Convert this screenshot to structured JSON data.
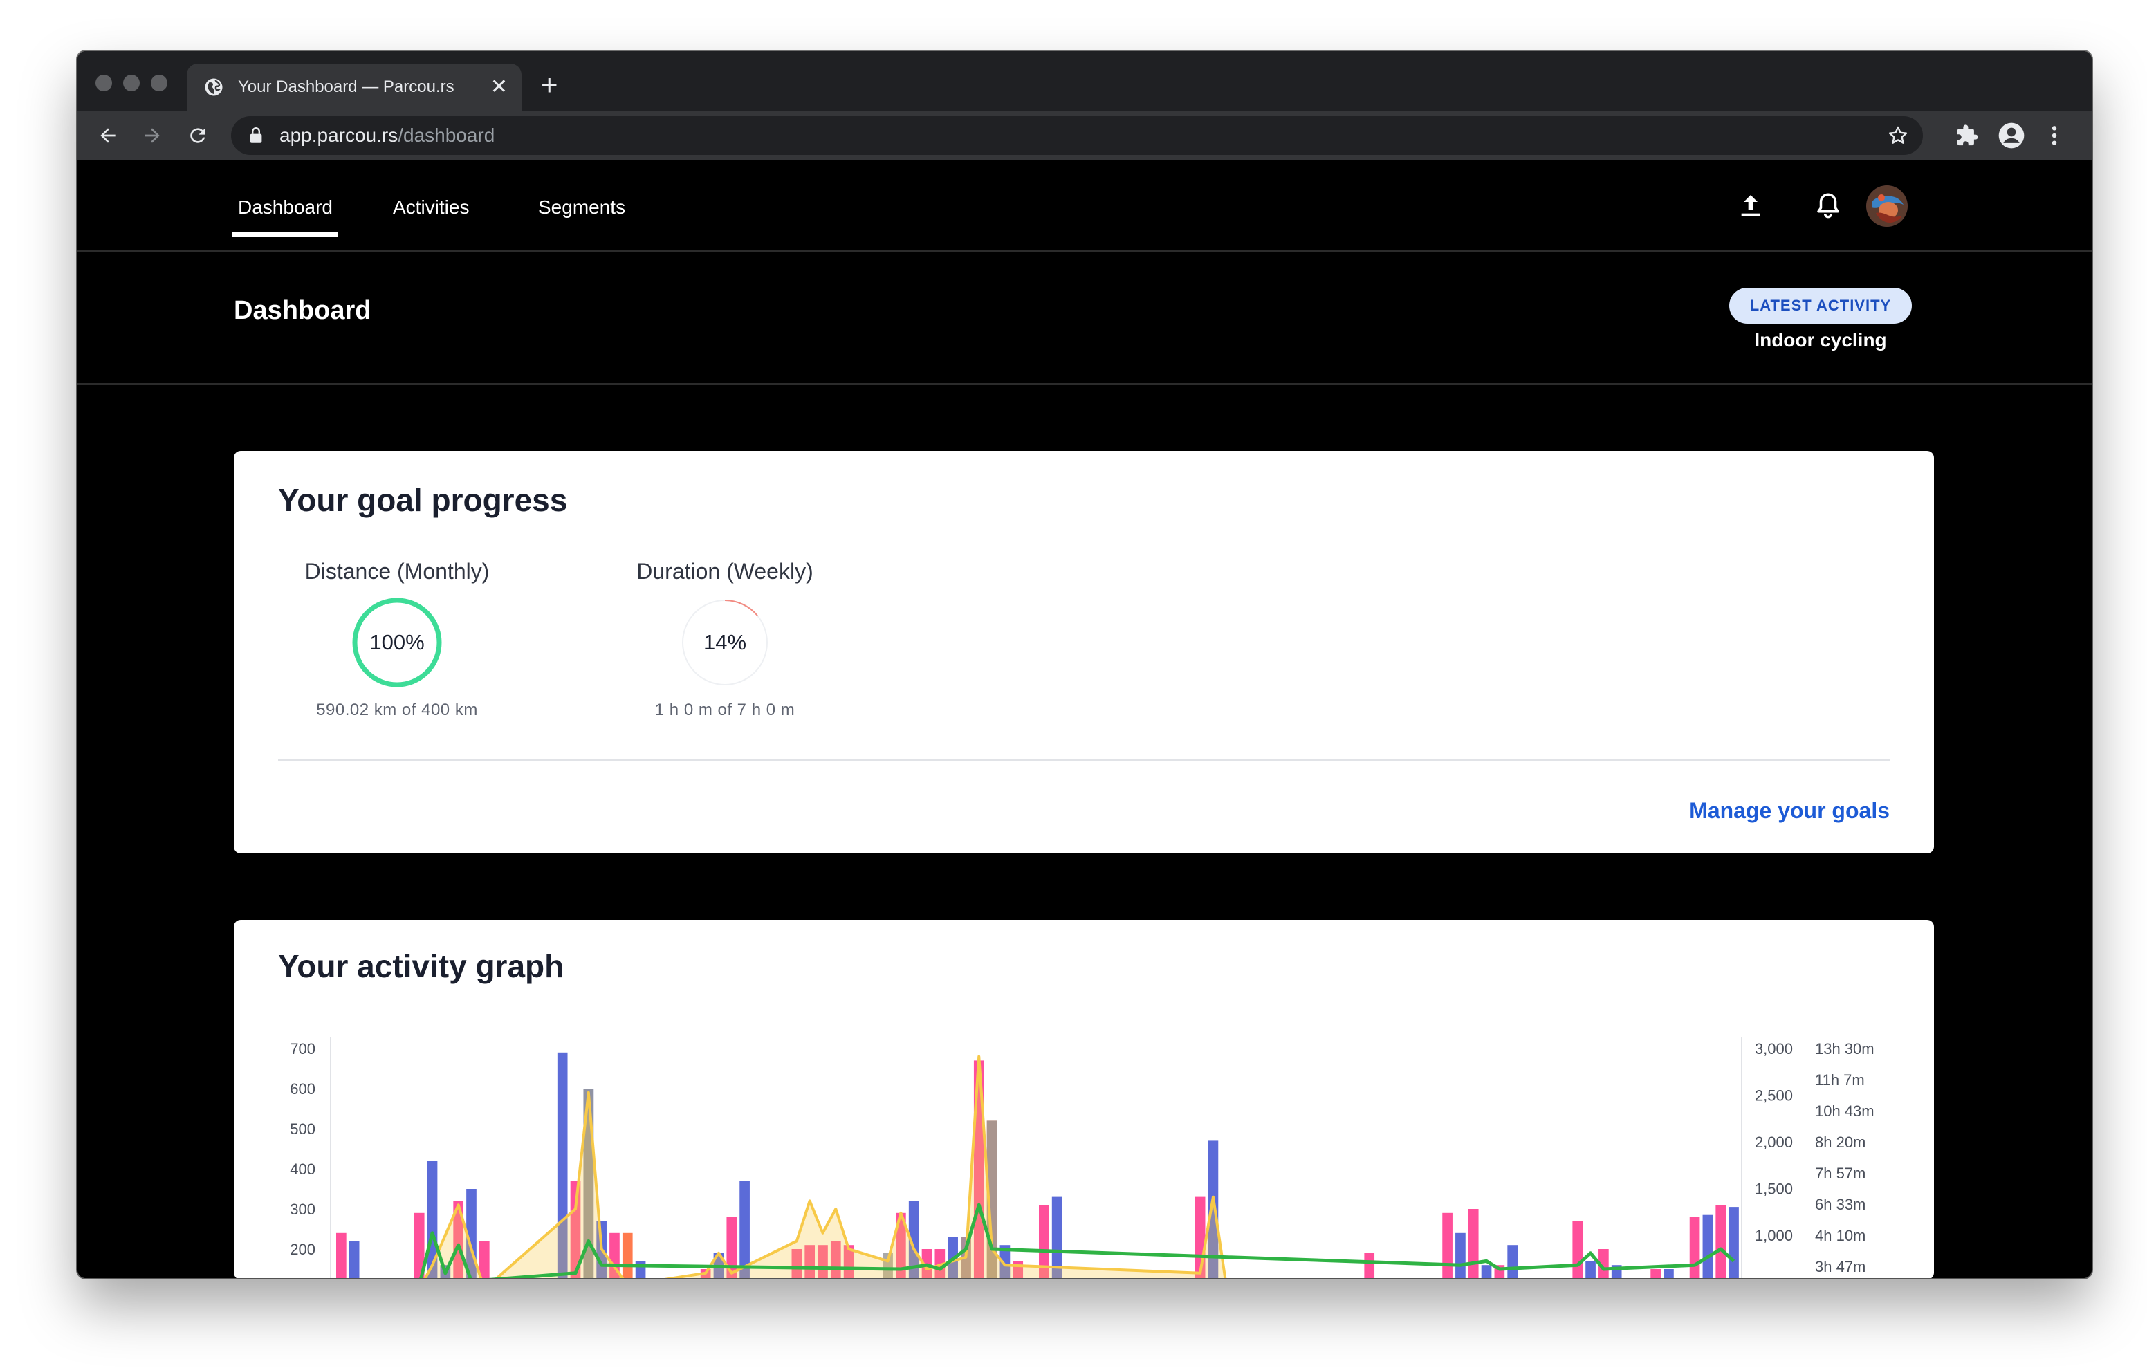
{
  "browser": {
    "tab_title": "Your Dashboard — Parcou.rs",
    "tab_close": "✕",
    "new_tab": "+",
    "url_host": "app.parcou.rs",
    "url_path": "/dashboard"
  },
  "nav": {
    "items": [
      {
        "label": "Dashboard",
        "active": true
      },
      {
        "label": "Activities",
        "active": false
      },
      {
        "label": "Segments",
        "active": false
      }
    ],
    "icons": [
      "upload-icon",
      "bell-icon",
      "avatar"
    ]
  },
  "header": {
    "title": "Dashboard",
    "latest_badge": "LATEST ACTIVITY",
    "latest_activity": "Indoor cycling"
  },
  "goals": {
    "title": "Your goal progress",
    "items": [
      {
        "name": "Distance (Monthly)",
        "percent_label": "100%",
        "progress": 1.0,
        "detail": "590.02 km of 400 km",
        "ring_color": "#3ddc97"
      },
      {
        "name": "Duration (Weekly)",
        "percent_label": "14%",
        "progress": 0.14,
        "detail": "1 h 0 m of 7 h 0 m",
        "ring_color": "#f28b82"
      }
    ],
    "manage_link": "Manage your goals"
  },
  "activity_graph": {
    "title": "Your activity graph"
  },
  "chart_data": {
    "type": "bar",
    "title": "",
    "left_axis_ticks": [
      "700",
      "600",
      "500",
      "400",
      "300",
      "200"
    ],
    "right_axis_ticks": [
      "3,000",
      "2,500",
      "2,000",
      "1,500",
      "1,000"
    ],
    "right_axis_2_ticks": [
      "13h 30m",
      "11h 7m",
      "10h 43m",
      "8h 20m",
      "7h 57m",
      "6h 33m",
      "4h 10m",
      "3h 47m"
    ],
    "ylim": [
      150,
      700
    ],
    "colors": {
      "pink": "#ff4f9a",
      "blue": "#5b6bd8",
      "orange": "#ff7a4d",
      "gray": "#9a9a9a",
      "yellow": "#f7c948",
      "green": "#2fb344"
    },
    "series": [
      {
        "kind": "bar",
        "color": "pink",
        "values": [
          [
            0,
            240
          ],
          [
            6,
            290
          ],
          [
            9,
            320
          ],
          [
            11,
            220
          ],
          [
            18,
            370
          ],
          [
            21,
            240
          ],
          [
            28,
            150
          ],
          [
            30,
            280
          ],
          [
            35,
            200
          ],
          [
            36,
            210
          ],
          [
            37,
            210
          ],
          [
            38,
            220
          ],
          [
            39,
            210
          ],
          [
            43,
            290
          ],
          [
            45,
            200
          ],
          [
            46,
            200
          ],
          [
            48,
            230
          ],
          [
            49,
            670
          ],
          [
            52,
            170
          ],
          [
            54,
            310
          ],
          [
            66,
            330
          ],
          [
            79,
            190
          ],
          [
            85,
            290
          ],
          [
            87,
            300
          ],
          [
            89,
            160
          ],
          [
            95,
            270
          ],
          [
            97,
            200
          ],
          [
            101,
            150
          ],
          [
            104,
            280
          ],
          [
            106,
            310
          ]
        ]
      },
      {
        "kind": "bar",
        "color": "blue",
        "values": [
          [
            1,
            220
          ],
          [
            7,
            420
          ],
          [
            8,
            160
          ],
          [
            10,
            350
          ],
          [
            17,
            690
          ],
          [
            19,
            600
          ],
          [
            20,
            270
          ],
          [
            23,
            170
          ],
          [
            29,
            190
          ],
          [
            31,
            370
          ],
          [
            44,
            320
          ],
          [
            47,
            230
          ],
          [
            51,
            210
          ],
          [
            55,
            330
          ],
          [
            67,
            470
          ],
          [
            86,
            240
          ],
          [
            88,
            160
          ],
          [
            90,
            210
          ],
          [
            96,
            170
          ],
          [
            98,
            160
          ],
          [
            102,
            150
          ],
          [
            105,
            285
          ],
          [
            107,
            305
          ]
        ]
      },
      {
        "kind": "bar",
        "color": "orange",
        "values": [
          [
            22,
            240
          ],
          [
            50,
            520
          ]
        ]
      },
      {
        "kind": "bar",
        "color": "gray",
        "values": [
          [
            19,
            600
          ],
          [
            42,
            190
          ],
          [
            48,
            230
          ],
          [
            50,
            520
          ]
        ]
      },
      {
        "kind": "line",
        "color": "yellow",
        "points": [
          [
            6,
            100
          ],
          [
            7,
            160
          ],
          [
            9,
            310
          ],
          [
            10,
            200
          ],
          [
            11,
            100
          ],
          [
            18,
            300
          ],
          [
            19,
            590
          ],
          [
            20,
            200
          ],
          [
            22,
            110
          ],
          [
            28,
            140
          ],
          [
            29,
            190
          ],
          [
            30,
            140
          ],
          [
            35,
            220
          ],
          [
            36,
            320
          ],
          [
            37,
            240
          ],
          [
            38,
            300
          ],
          [
            39,
            200
          ],
          [
            40,
            190
          ],
          [
            42,
            170
          ],
          [
            43,
            290
          ],
          [
            44,
            200
          ],
          [
            45,
            150
          ],
          [
            48,
            180
          ],
          [
            49,
            680
          ],
          [
            50,
            200
          ],
          [
            51,
            160
          ],
          [
            66,
            140
          ],
          [
            67,
            330
          ],
          [
            68,
            110
          ]
        ]
      },
      {
        "kind": "line",
        "color": "green",
        "points": [
          [
            6,
            110
          ],
          [
            7,
            240
          ],
          [
            8,
            140
          ],
          [
            9,
            210
          ],
          [
            10,
            120
          ],
          [
            18,
            140
          ],
          [
            19,
            220
          ],
          [
            20,
            160
          ],
          [
            43,
            150
          ],
          [
            45,
            160
          ],
          [
            46,
            150
          ],
          [
            48,
            200
          ],
          [
            49,
            310
          ],
          [
            50,
            200
          ],
          [
            86,
            160
          ],
          [
            88,
            170
          ],
          [
            89,
            150
          ],
          [
            95,
            160
          ],
          [
            96,
            190
          ],
          [
            97,
            150
          ],
          [
            104,
            160
          ],
          [
            106,
            200
          ],
          [
            107,
            170
          ]
        ]
      }
    ]
  }
}
